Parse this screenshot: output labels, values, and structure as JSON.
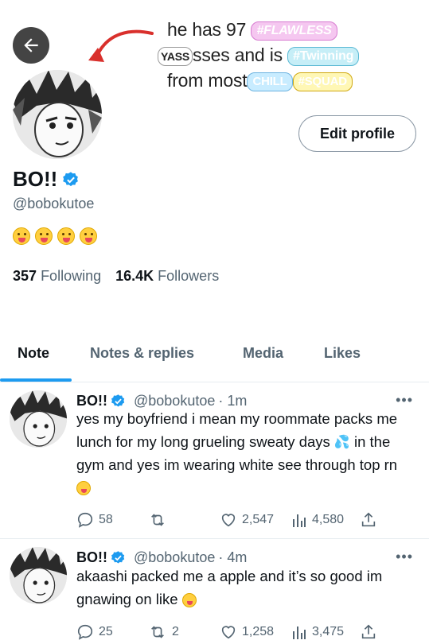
{
  "banner": {
    "line1_text": "he has 97",
    "line1_badge": "#FLAWLESS",
    "line2_badge": "YASS",
    "line2_text": "sses and is",
    "line2_badge2": "#Twinning",
    "line3_text": "from most",
    "line3_badge": "CHILL",
    "line3_badge2": "#SQUAD"
  },
  "profile": {
    "name": "BO!!",
    "handle": "@bobokutoe",
    "edit_label": "Edit profile",
    "following_count": "357",
    "following_label": "Following",
    "followers_count": "16.4K",
    "followers_label": "Followers"
  },
  "tabs": [
    {
      "label": "Note"
    },
    {
      "label": "Notes & replies"
    },
    {
      "label": "Media"
    },
    {
      "label": "Likes"
    }
  ],
  "tweets": [
    {
      "name": "BO!!",
      "handle": "@bobokutoe",
      "time": "· 1m",
      "text_part1": "yes my boyfriend i mean my roommate packs me lunch for my long grueling sweaty days",
      "text_part2": "in the gym and yes im wearing white see through top rn",
      "replies": "58",
      "retweets": "",
      "likes": "2,547",
      "views": "4,580"
    },
    {
      "name": "BO!!",
      "handle": "@bobokutoe",
      "time": "· 4m",
      "text_part1": "akaashi packed me a apple and it’s so good im gnawing on like",
      "replies": "25",
      "retweets": "2",
      "likes": "1,258",
      "views": "3,475"
    }
  ],
  "colors": {
    "accent": "#1d9bf0",
    "verified": "#1d9bf0",
    "arrow": "#d9302c"
  }
}
